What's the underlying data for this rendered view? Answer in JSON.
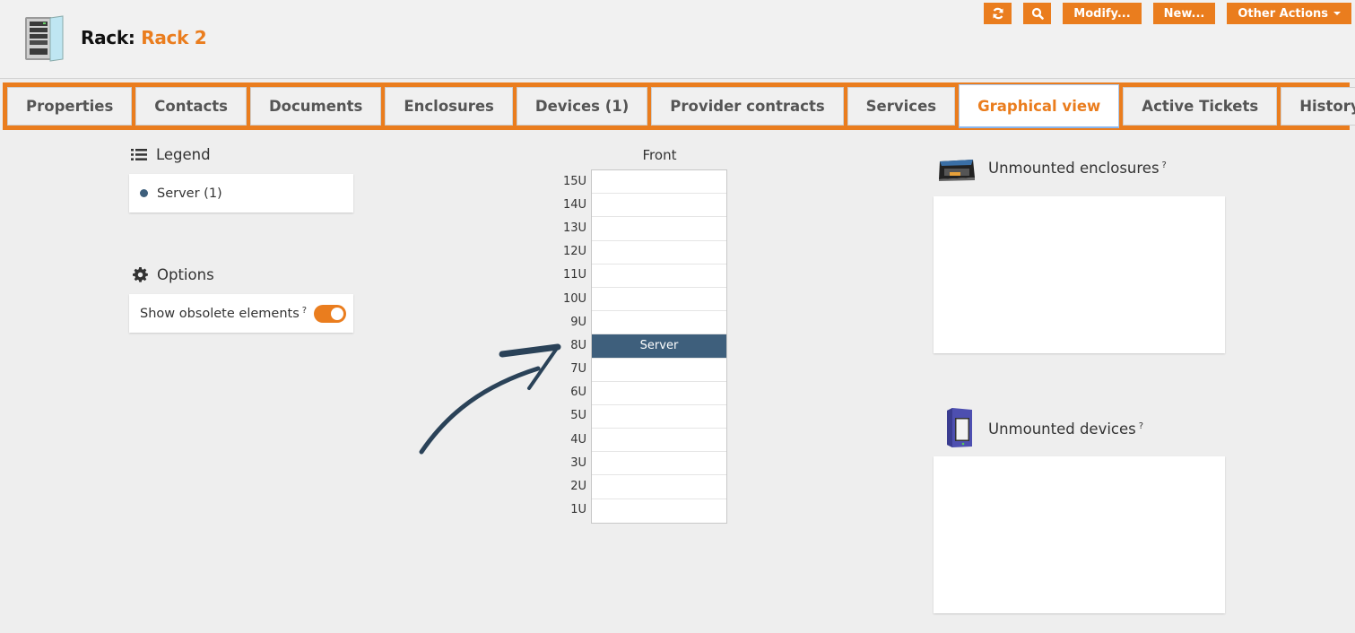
{
  "header": {
    "object_type": "Rack:",
    "object_name": "Rack 2",
    "icon": "rack-icon"
  },
  "actions": {
    "refresh": {
      "icon": "refresh-icon"
    },
    "search": {
      "icon": "search-icon"
    },
    "modify_label": "Modify...",
    "new_label": "New...",
    "other_actions_label": "Other Actions"
  },
  "tabs": [
    {
      "label": "Properties",
      "active": false
    },
    {
      "label": "Contacts",
      "active": false
    },
    {
      "label": "Documents",
      "active": false
    },
    {
      "label": "Enclosures",
      "active": false
    },
    {
      "label": "Devices (1)",
      "active": false
    },
    {
      "label": "Provider contracts",
      "active": false
    },
    {
      "label": "Services",
      "active": false
    },
    {
      "label": "Graphical view",
      "active": true
    },
    {
      "label": "Active Tickets",
      "active": false
    },
    {
      "label": "History",
      "active": false
    }
  ],
  "legend": {
    "title": "Legend",
    "items": [
      {
        "label": "Server (1)",
        "color": "#3e5f7c"
      }
    ]
  },
  "options": {
    "title": "Options",
    "show_obsolete_label": "Show obsolete elements",
    "help_mark": "?",
    "show_obsolete_enabled": true
  },
  "rack_view": {
    "face_label": "Front",
    "units": [
      "15U",
      "14U",
      "13U",
      "12U",
      "11U",
      "10U",
      "9U",
      "8U",
      "7U",
      "6U",
      "5U",
      "4U",
      "3U",
      "2U",
      "1U"
    ],
    "devices": [
      {
        "label": "Server",
        "unit": "8U",
        "color": "#3e5f7c"
      }
    ]
  },
  "unmounted_enclosures": {
    "title": "Unmounted enclosures",
    "help_mark": "?"
  },
  "unmounted_devices": {
    "title": "Unmounted devices",
    "help_mark": "?"
  },
  "colors": {
    "accent": "#ea7d1e",
    "device": "#3e5f7c"
  }
}
